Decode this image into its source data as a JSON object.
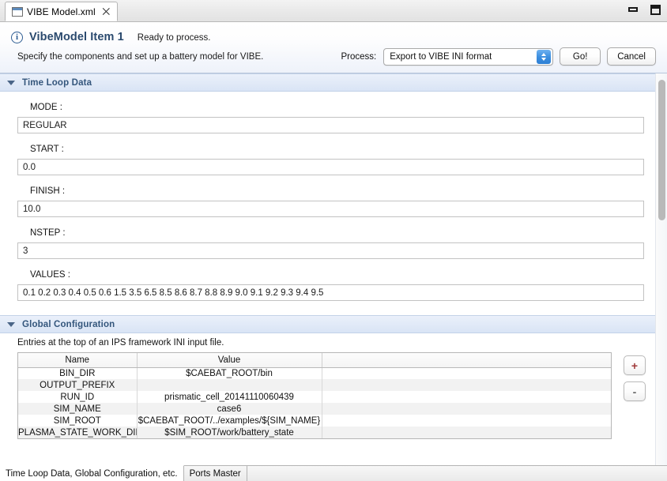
{
  "window": {
    "tab_label": "VIBE Model.xml",
    "tab_close_glyph": "⨉",
    "minimize_title": "Minimize",
    "maximize_title": "Maximize"
  },
  "header": {
    "title": "VibeModel Item 1",
    "status": "Ready to process.",
    "description": "Specify the components and set up a battery model for VIBE.",
    "info_glyph": "i",
    "process_label": "Process:",
    "process_selected": "Export to VIBE INI format",
    "go_label": "Go!",
    "cancel_label": "Cancel"
  },
  "time_loop_section": {
    "title": "Time Loop Data",
    "fields": [
      {
        "label": "MODE :",
        "value": "REGULAR"
      },
      {
        "label": "START :",
        "value": "0.0"
      },
      {
        "label": "FINISH :",
        "value": "10.0"
      },
      {
        "label": "NSTEP :",
        "value": "3"
      },
      {
        "label": "VALUES :",
        "value": "0.1 0.2 0.3 0.4 0.5 0.6 1.5 3.5 6.5 8.5 8.6 8.7 8.8 8.9 9.0 9.1 9.2 9.3 9.4 9.5"
      }
    ]
  },
  "global_config_section": {
    "title": "Global Configuration",
    "description": "Entries at the top of an IPS framework INI input file.",
    "columns": [
      "Name",
      "Value",
      ""
    ],
    "rows": [
      {
        "name": "BIN_DIR",
        "value": "$CAEBAT_ROOT/bin",
        "extra": ""
      },
      {
        "name": "OUTPUT_PREFIX",
        "value": "",
        "extra": ""
      },
      {
        "name": "RUN_ID",
        "value": "prismatic_cell_20141110060439",
        "extra": ""
      },
      {
        "name": "SIM_NAME",
        "value": "case6",
        "extra": ""
      },
      {
        "name": "SIM_ROOT",
        "value": "$CAEBAT_ROOT/../examples/${SIM_NAME}",
        "extra": ""
      },
      {
        "name": "PLASMA_STATE_WORK_DIR",
        "value": "$SIM_ROOT/work/battery_state",
        "extra": ""
      }
    ],
    "add_label": "+",
    "remove_label": "-"
  },
  "bottom_tabs": {
    "tabs": [
      {
        "label": "Time Loop Data, Global Configuration, etc.",
        "selected": true
      },
      {
        "label": "Ports Master",
        "selected": false
      }
    ]
  },
  "colors": {
    "accent_blue": "#2d7fd4",
    "header_title": "#2b4a6e",
    "section_title": "#34567c",
    "section_bg": "#e0e9f7",
    "plus_icon": "#a03a3a"
  }
}
